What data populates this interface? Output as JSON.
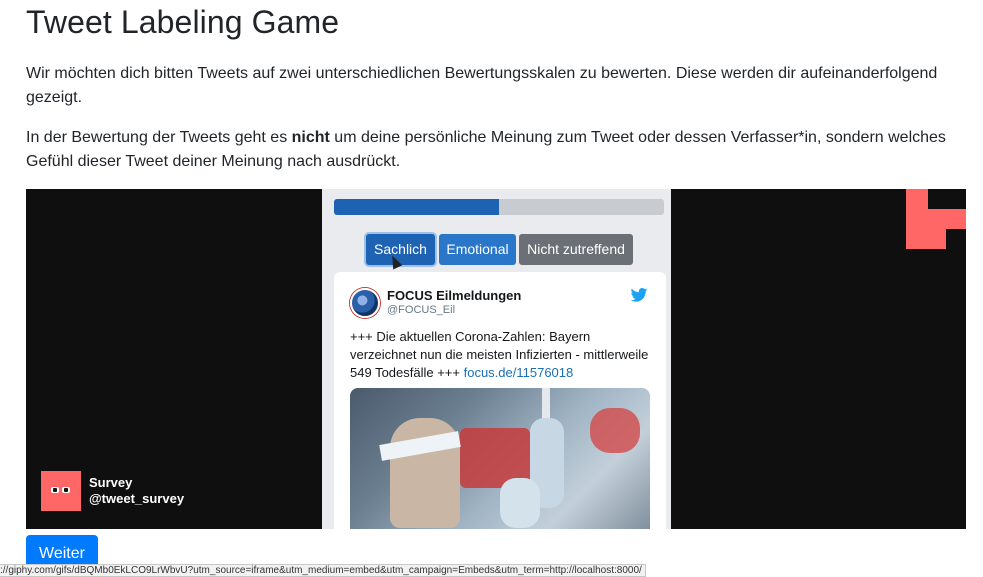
{
  "page": {
    "title": "Tweet Labeling Game",
    "intro": "Wir möchten dich bitten Tweets auf zwei unterschiedlichen Bewertungsskalen zu bewerten. Diese werden dir aufeinanderfolgend gezeigt.",
    "instruction_before": "In der Bewertung der Tweets geht es ",
    "instruction_bold": "nicht",
    "instruction_after": " um deine persönliche Meinung zum Tweet oder dessen Verfasser*in, sondern welches Gefühl dieser Tweet deiner Meinung nach ausdrückt."
  },
  "embed": {
    "progress_fraction": 0.5,
    "buttons": {
      "sachlich": "Sachlich",
      "emotional": "Emotional",
      "nicht": "Nicht zutreffend"
    },
    "tweet": {
      "account_name": "FOCUS Eilmeldungen",
      "account_handle": "@FOCUS_Eil",
      "text": "+++ Die aktuellen Corona-Zahlen: Bayern verzeichnet nun die meisten Infizierten - mittlerweile 549 Todesfälle +++ ",
      "link": "focus.de/11576018"
    },
    "source_badge": {
      "name": "Survey",
      "handle": "@tweet_survey"
    }
  },
  "actions": {
    "weiter": "Weiter"
  },
  "status_bar": {
    "url": "://giphy.com/gifs/dBQMb0EkLCO9LrWbvU?utm_source=iframe&utm_medium=embed&utm_campaign=Embeds&utm_term=http://localhost:8000/"
  },
  "colors": {
    "primary": "#007bff",
    "brand_pink": "#ff6666",
    "progress": "#1e63b3",
    "neutral_button": "#6b7076"
  }
}
